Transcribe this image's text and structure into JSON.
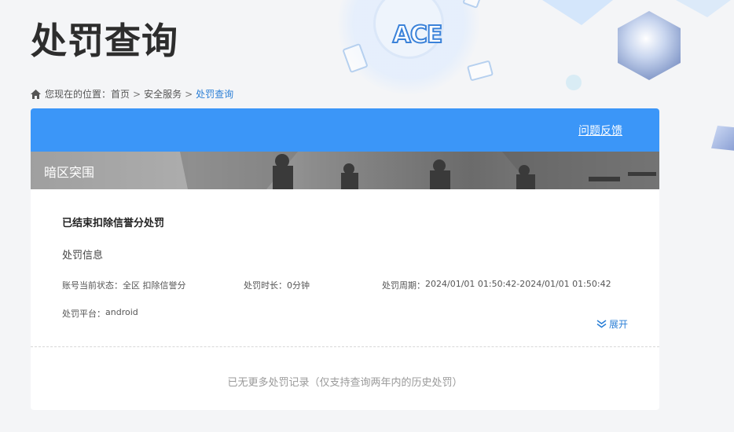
{
  "page": {
    "title": "处罚查询",
    "logo_text": "ACE"
  },
  "breadcrumb": {
    "prefix": "您现在的位置：",
    "items": [
      "首页",
      "安全服务"
    ],
    "current": "处罚查询",
    "separator": ">"
  },
  "panel": {
    "feedback_label": "问题反馈",
    "game_name": "暗区突围",
    "header_color": "#3b96f8"
  },
  "record": {
    "title": "已结束扣除信誉分处罚",
    "section_label": "处罚信息",
    "status_label": "账号当前状态：",
    "status_value": "全区 扣除信誉分",
    "duration_label": "处罚时长：",
    "duration_value": "0分钟",
    "period_label": "处罚周期：",
    "period_value": "2024/01/01 01:50:42-2024/01/01 01:50:42",
    "platform_label": "处罚平台：",
    "platform_value": "android",
    "expand_label": "展开"
  },
  "footer": {
    "note": "已无更多处罚记录（仅支持查询两年内的历史处罚）"
  },
  "icons": {
    "home": "home-icon",
    "expand": "double-chevron-down-icon"
  }
}
